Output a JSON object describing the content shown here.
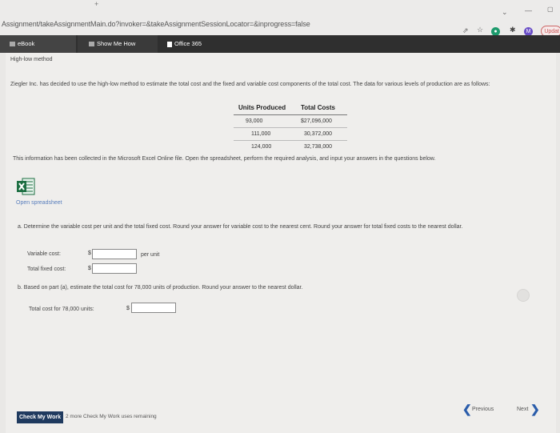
{
  "browser": {
    "url": "Assignment/takeAssignmentMain.do?invoker=&takeAssignmentSessionLocator=&inprogress=false",
    "plus_mark": "+",
    "update_label": "Updat",
    "profile_letter": "M"
  },
  "toolbar": {
    "ebook_label": "eBook",
    "show_me_how_label": "Show Me How",
    "office_label": "Office 365"
  },
  "problem": {
    "title": "High-low method",
    "intro": "Ziegler Inc. has decided to use the high-low method to estimate the total cost and the fixed and variable cost components of the total cost. The data for various levels of production are as follows:",
    "table": {
      "headers": [
        "Units Produced",
        "Total Costs"
      ],
      "rows": [
        [
          "93,000",
          "$27,096,000"
        ],
        [
          "111,000",
          "30,372,000"
        ],
        [
          "124,000",
          "32,738,000"
        ]
      ]
    },
    "info_text": "This information has been collected in the Microsoft Excel Online file. Open the spreadsheet, perform the required analysis, and input your answers in the questions below.",
    "open_spreadsheet": "Open spreadsheet"
  },
  "part_a": {
    "question": "a. Determine the variable cost per unit and the total fixed cost. Round your answer for variable cost to the nearest cent. Round your answer for total fixed costs to the nearest dollar.",
    "variable_cost_label": "Variable cost:",
    "variable_cost_value": "",
    "per_unit": "per unit",
    "total_fixed_label": "Total fixed cost:",
    "total_fixed_value": "",
    "currency": "$"
  },
  "part_b": {
    "question": "b. Based on part (a), estimate the total cost for 78,000 units of production. Round your answer to the nearest dollar.",
    "total_cost_label": "Total cost for 78,000 units:",
    "total_cost_value": "",
    "currency": "$"
  },
  "footer": {
    "check_button": "Check My Work",
    "remaining": "2 more Check My Work uses remaining",
    "previous": "Previous",
    "next": "Next"
  },
  "colors": {
    "toolbar_bg": "#2f2f2f",
    "check_button_bg": "#1f3a5f",
    "link": "#5a7fbd",
    "nav_chevron": "#2a5caa"
  }
}
